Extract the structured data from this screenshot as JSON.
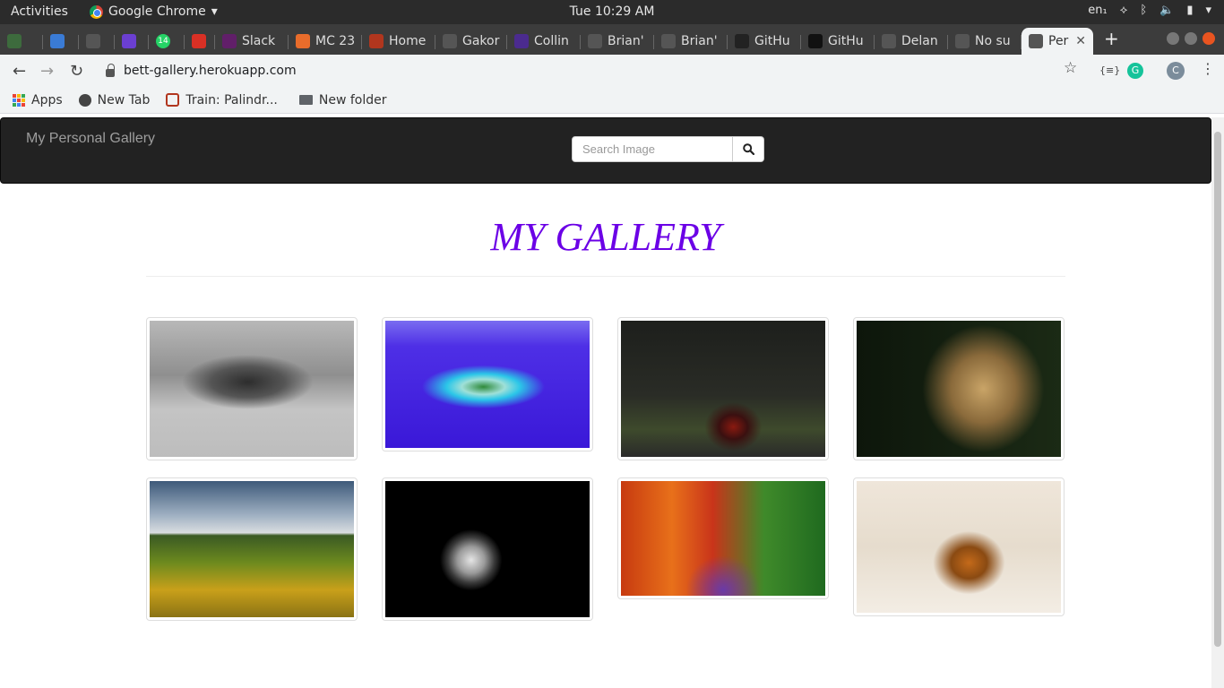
{
  "system_bar": {
    "activities": "Activities",
    "app_name": "Google Chrome",
    "clock": "Tue 10:29 AM",
    "keyboard": "en₁"
  },
  "tabs": [
    {
      "label": "",
      "color": "#3d6b3d"
    },
    {
      "label": "",
      "color": "#3a7bd5"
    },
    {
      "label": "",
      "color": "#555555"
    },
    {
      "label": "",
      "color": "#6b3fd1"
    },
    {
      "label": "",
      "color": "#25d366"
    },
    {
      "label": "",
      "color": "#d93025"
    },
    {
      "label": "Slack",
      "color": "#611f69"
    },
    {
      "label": "MC 23",
      "color": "#e86c2b"
    },
    {
      "label": "Home",
      "color": "#b1361e"
    },
    {
      "label": "Gakor",
      "color": "#555555"
    },
    {
      "label": "Collin",
      "color": "#4b2b8f"
    },
    {
      "label": "Brian'",
      "color": "#555555"
    },
    {
      "label": "Brian'",
      "color": "#555555"
    },
    {
      "label": "GitHu",
      "color": "#222222"
    },
    {
      "label": "GitHu",
      "color": "#111111"
    },
    {
      "label": "Delan",
      "color": "#555555"
    },
    {
      "label": "No su",
      "color": "#555555"
    },
    {
      "label": "Per",
      "color": "#555555"
    }
  ],
  "tab_badge": "14",
  "browser": {
    "url": "bett-gallery.herokuapp.com",
    "profile_initial": "C",
    "ext_label": "{≡}"
  },
  "bookmarks": [
    {
      "label": "Apps",
      "icon": "apps-grid-icon"
    },
    {
      "label": "New Tab",
      "icon": "globe-icon"
    },
    {
      "label": "Train: Palindr...",
      "icon": "codewars-icon"
    },
    {
      "label": "New folder",
      "icon": "folder-icon"
    }
  ],
  "site": {
    "brand": "My Personal Gallery",
    "search_placeholder": "Search Image",
    "heading": "MY GALLERY",
    "heading_color": "#6b00e6"
  },
  "gallery": [
    {
      "subject": "misty-mountains"
    },
    {
      "subject": "tropical-island"
    },
    {
      "subject": "motorcycle-racer"
    },
    {
      "subject": "lion"
    },
    {
      "subject": "sunflower-field"
    },
    {
      "subject": "skull"
    },
    {
      "subject": "autumn-road"
    },
    {
      "subject": "tigers-in-snow"
    }
  ]
}
